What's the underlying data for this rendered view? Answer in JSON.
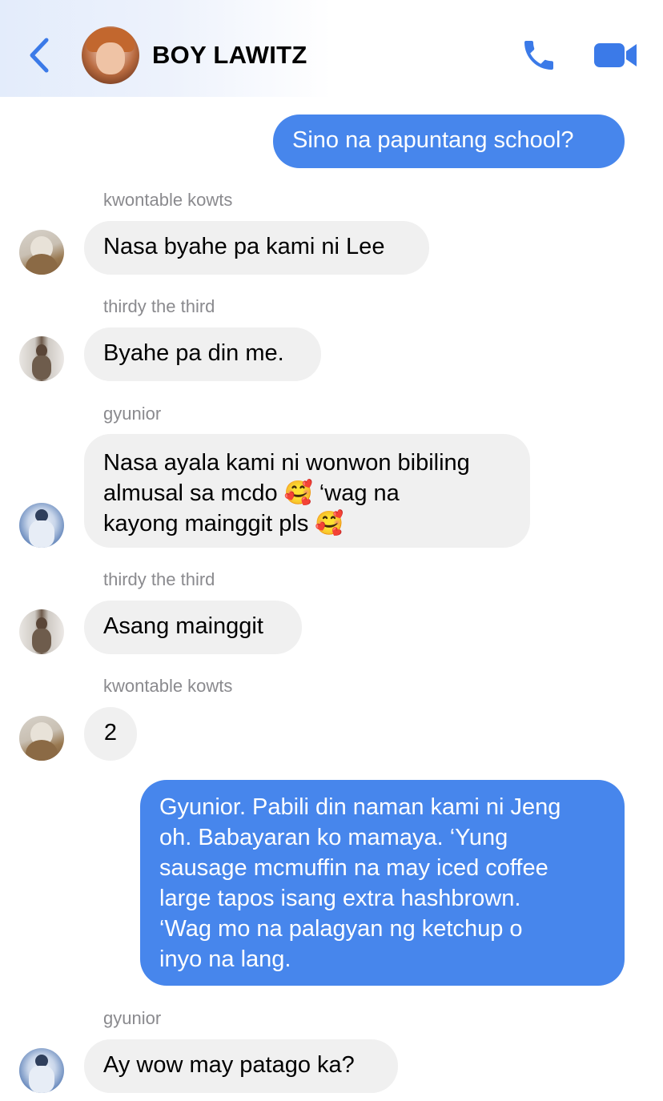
{
  "header": {
    "title": "BOY LAWITZ",
    "accent_color": "#3b7ae8",
    "icons": [
      "chevron-left-icon",
      "phone-icon",
      "video-camera-icon"
    ]
  },
  "messages": [
    {
      "direction": "out",
      "text": "Sino na papuntang school?"
    },
    {
      "direction": "in",
      "sender": "kwontable kowts",
      "text": "Nasa byahe pa kami ni Lee"
    },
    {
      "direction": "in",
      "sender": "thirdy the third",
      "text": "Byahe pa din me."
    },
    {
      "direction": "in",
      "sender": "gyunior",
      "text": "Nasa ayala kami ni wonwon bibiling\nalmusal sa mcdo 🥰 ‘wag na\nkayong mainggit pls 🥰"
    },
    {
      "direction": "in",
      "sender": "thirdy the third",
      "text": "Asang mainggit"
    },
    {
      "direction": "in",
      "sender": "kwontable kowts",
      "text": "2"
    },
    {
      "direction": "out",
      "text": "Gyunior. Pabili din naman kami ni Jeng\noh. Babayaran ko mamaya. ‘Yung\nsausage mcmuffin na may iced coffee\nlarge tapos isang extra hashbrown.\n‘Wag mo na palagyan ng ketchup o\ninyo na lang."
    },
    {
      "direction": "in",
      "sender": "gyunior",
      "text": "Ay wow may patago ka?"
    }
  ],
  "colors": {
    "outgoing_bubble": "#4786ec",
    "incoming_bubble": "#f0f0f0",
    "sender_name": "#8a8a8e"
  }
}
